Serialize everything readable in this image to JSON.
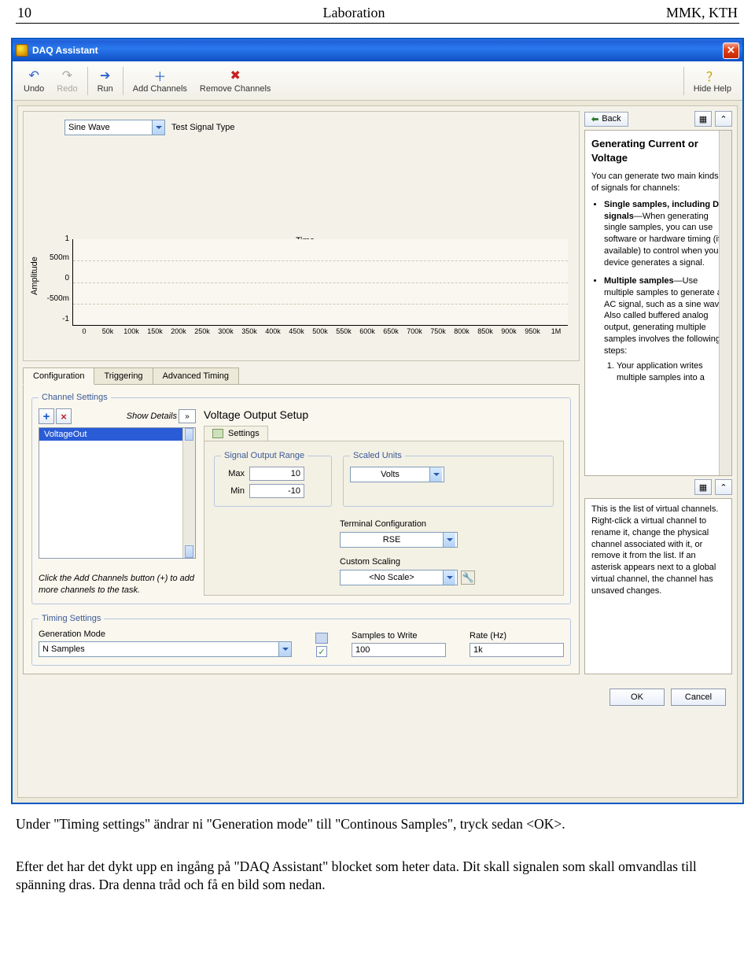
{
  "doc": {
    "page_no": "10",
    "title": "Laboration",
    "right": "MMK, KTH",
    "para1": "Under \"Timing settings\" ändrar ni \"Generation mode\" till \"Continous Samples\", tryck sedan <OK>.",
    "para2": "Efter det har det dykt upp en ingång på \"DAQ Assistant\" blocket som heter data. Dit skall signalen som skall omvandlas till spänning dras. Dra denna tråd och få en bild som nedan."
  },
  "win": {
    "title": "DAQ Assistant"
  },
  "toolbar": {
    "undo": "Undo",
    "redo": "Redo",
    "run": "Run",
    "add": "Add Channels",
    "remove": "Remove Channels",
    "hide": "Hide Help"
  },
  "signal": {
    "dd_value": "Sine Wave",
    "type_lbl": "Test Signal Type",
    "ylabel": "Amplitude",
    "xlabel": "Time",
    "yticks": [
      "1",
      "500m",
      "0",
      "-500m",
      "-1"
    ],
    "xticks": [
      "0",
      "50k",
      "100k",
      "150k",
      "200k",
      "250k",
      "300k",
      "350k",
      "400k",
      "450k",
      "500k",
      "550k",
      "600k",
      "650k",
      "700k",
      "750k",
      "800k",
      "850k",
      "900k",
      "950k",
      "1M"
    ]
  },
  "tabs": {
    "config": "Configuration",
    "trig": "Triggering",
    "adv": "Advanced Timing"
  },
  "channel": {
    "legend": "Channel Settings",
    "show_details": "Show Details",
    "selected": "VoltageOut",
    "hint": "Click the Add Channels button (+) to add more channels to the task."
  },
  "setup": {
    "title": "Voltage Output Setup",
    "settings_tab": "Settings",
    "range_legend": "Signal Output Range",
    "max_lbl": "Max",
    "max_val": "10",
    "min_lbl": "Min",
    "min_val": "-10",
    "units_legend": "Scaled Units",
    "units_val": "Volts",
    "term_lbl": "Terminal Configuration",
    "term_val": "RSE",
    "cscale_lbl": "Custom Scaling",
    "cscale_val": "<No Scale>"
  },
  "timing": {
    "legend": "Timing Settings",
    "mode_lbl": "Generation Mode",
    "mode_val": "N Samples",
    "samples_lbl": "Samples to Write",
    "samples_val": "100",
    "rate_lbl": "Rate (Hz)",
    "rate_val": "1k"
  },
  "buttons": {
    "ok": "OK",
    "cancel": "Cancel"
  },
  "help": {
    "back": "Back",
    "title": "Generating Current or Voltage",
    "intro": "You can generate two main kinds of signals for channels:",
    "b1_strong": "Single samples, including DC signals",
    "b1_rest": "—When generating single samples, you can use software or hardware timing (if available) to control when your device generates a signal.",
    "b2_strong": "Multiple samples",
    "b2_rest": "—Use multiple samples to generate an AC signal, such as a sine wave. Also called buffered analog output, generating multiple samples involves the following steps:",
    "b2_step": "Your application writes multiple samples into a",
    "lower": "This is the list of virtual channels. Right-click a virtual channel to rename it, change the physical channel associated with it, or remove it from the list. If an asterisk appears next to a global virtual channel, the channel has unsaved changes."
  }
}
